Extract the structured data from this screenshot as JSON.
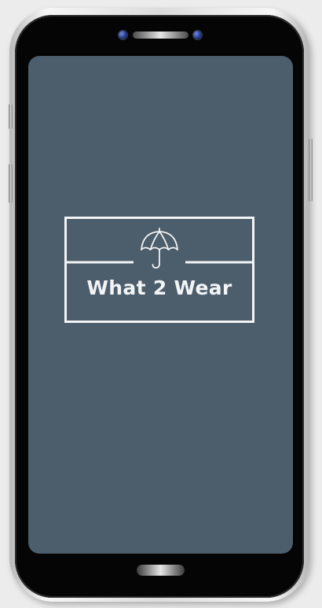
{
  "app": {
    "title": "What 2 Wear",
    "logo_icon": "umbrella-icon"
  },
  "colors": {
    "screen_background": "#4c5d6b",
    "logo_foreground": "#f2f4f5",
    "bezel": "#050505"
  }
}
